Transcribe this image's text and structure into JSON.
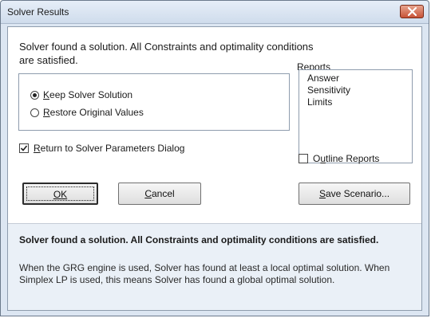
{
  "window": {
    "title": "Solver Results"
  },
  "message": "Solver found a solution.  All Constraints and optimality conditions are satisfied.",
  "reports": {
    "label": "Reports",
    "items": [
      "Answer",
      "Sensitivity",
      "Limits"
    ]
  },
  "options": {
    "keep_prefix": "",
    "keep_key": "K",
    "keep_rest": "eep Solver Solution",
    "restore_key": "R",
    "restore_rest": "estore Original Values",
    "selected": "keep"
  },
  "return_dialog": {
    "key": "R",
    "rest": "eturn to Solver Parameters Dialog",
    "checked": true
  },
  "outline_reports": {
    "prefix": "O",
    "key": "u",
    "rest": "tline Reports",
    "checked": false
  },
  "buttons": {
    "ok_key": "O",
    "ok_rest": "K",
    "cancel_key": "C",
    "cancel_rest": "ancel",
    "save_key": "S",
    "save_rest": "ave Scenario..."
  },
  "info": {
    "heading": "Solver found a solution.  All Constraints and optimality conditions are satisfied.",
    "body": "When the GRG engine is used, Solver has found at least a local optimal solution. When Simplex LP is used, this means Solver has found a global optimal solution."
  },
  "colors": {
    "titlebar": "#cfdcec",
    "close_button": "#c75337",
    "info_background": "#eaf0f7"
  }
}
